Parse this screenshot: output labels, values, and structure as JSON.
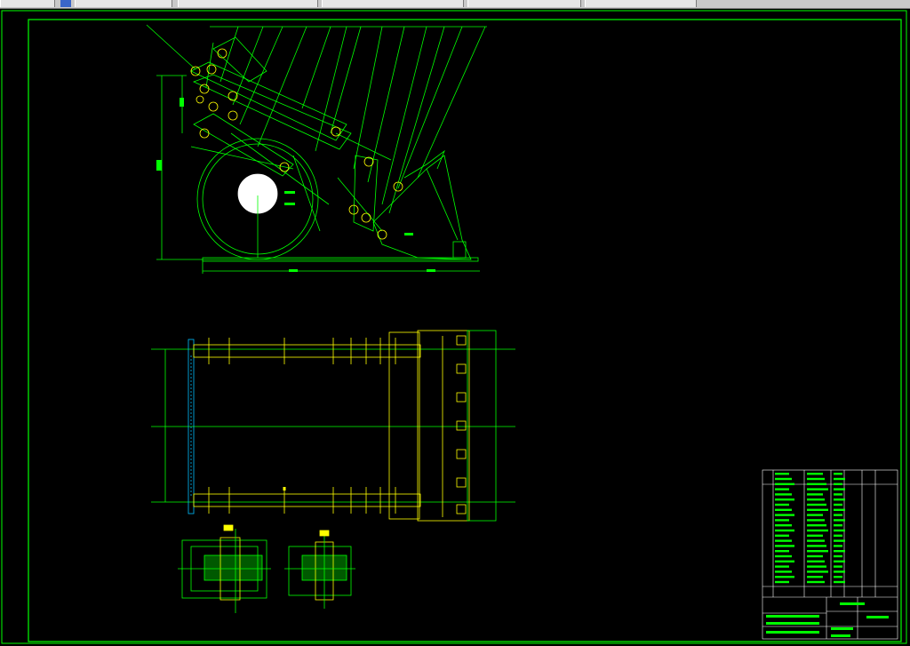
{
  "toolbar": {
    "slots": [
      "",
      "",
      "",
      "",
      "",
      ""
    ],
    "icon": "grid-icon"
  },
  "drawing": {
    "background": "#000000",
    "frame_color": "#00ff00",
    "line_color": "#00ff00",
    "part_color": "#ffff00",
    "accent_color": "#00bfff"
  }
}
